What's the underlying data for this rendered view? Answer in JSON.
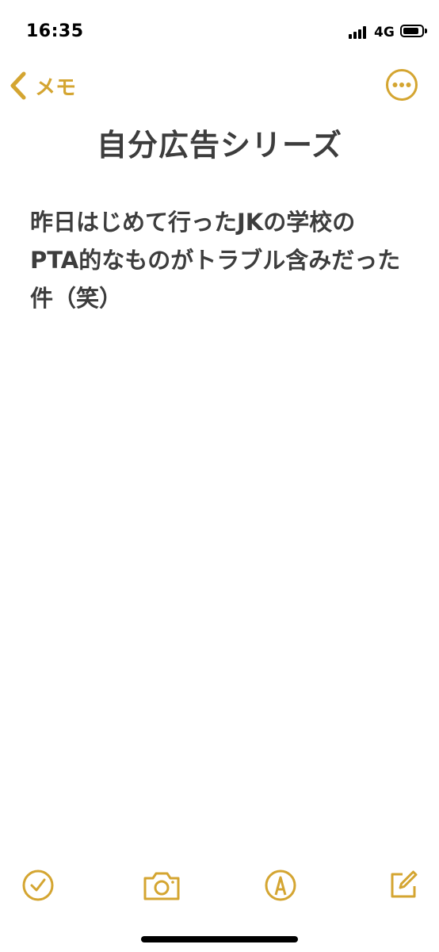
{
  "status_bar": {
    "time": "16:35",
    "network": "4G",
    "signal_bars": 4,
    "battery_level": 0.85
  },
  "nav": {
    "back_label": "メモ",
    "back_icon": "chevron-left-icon",
    "more_icon": "ellipsis-circle-icon"
  },
  "note": {
    "title": "自分広告シリーズ",
    "body": "昨日はじめて行ったJKの学校の\nPTA的なものがトラブル含みだった件（笑）"
  },
  "toolbar": {
    "icons": [
      "checklist-icon",
      "camera-icon",
      "markup-pen-icon",
      "compose-icon"
    ]
  },
  "colors": {
    "accent": "#d4a531",
    "text": "#3d3d3d",
    "background": "#ffffff"
  }
}
